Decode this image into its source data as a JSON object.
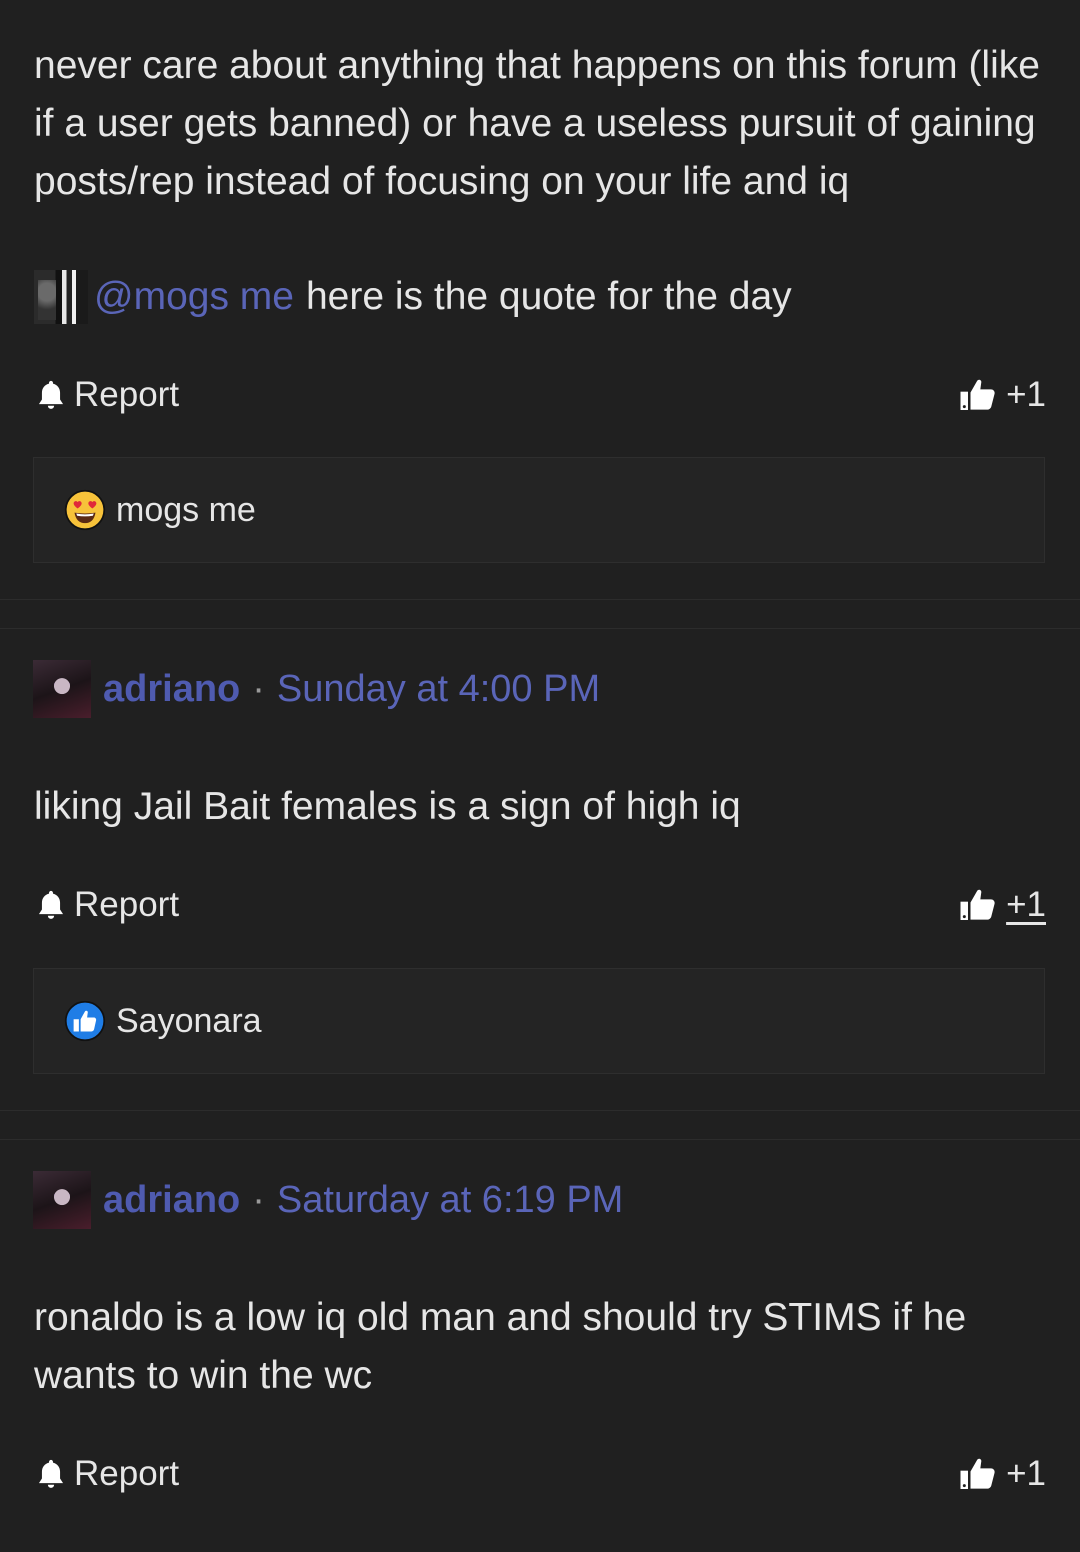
{
  "posts": [
    {
      "body": "never care about anything that happens on this forum (like if a user gets banned) or have a useless pursuit of gaining posts/rep instead of focusing on your life and iq",
      "mention": "@mogs me",
      "mention_suffix": "here is the quote for the day",
      "report_label": "Report",
      "like_count": "+1",
      "reaction_user": "mogs me",
      "reaction_icon": "heart-eyes-emoji-icon"
    },
    {
      "username": "adriano",
      "separator": "·",
      "timestamp": "Sunday at 4:00 PM",
      "body": "liking Jail Bait females is a sign of high iq",
      "report_label": "Report",
      "like_count": "+1",
      "reaction_user": "Sayonara",
      "reaction_icon": "thumbs-up-reaction-icon"
    },
    {
      "username": "adriano",
      "separator": "·",
      "timestamp": "Saturday at 6:19 PM",
      "body": "ronaldo is a low iq old man and should try STIMS if he wants to win the wc",
      "report_label": "Report",
      "like_count": "+1"
    }
  ],
  "colors": {
    "background": "#202020",
    "text": "#e6e6e6",
    "link": "#5a65b8",
    "username": "#4f5bb0"
  }
}
